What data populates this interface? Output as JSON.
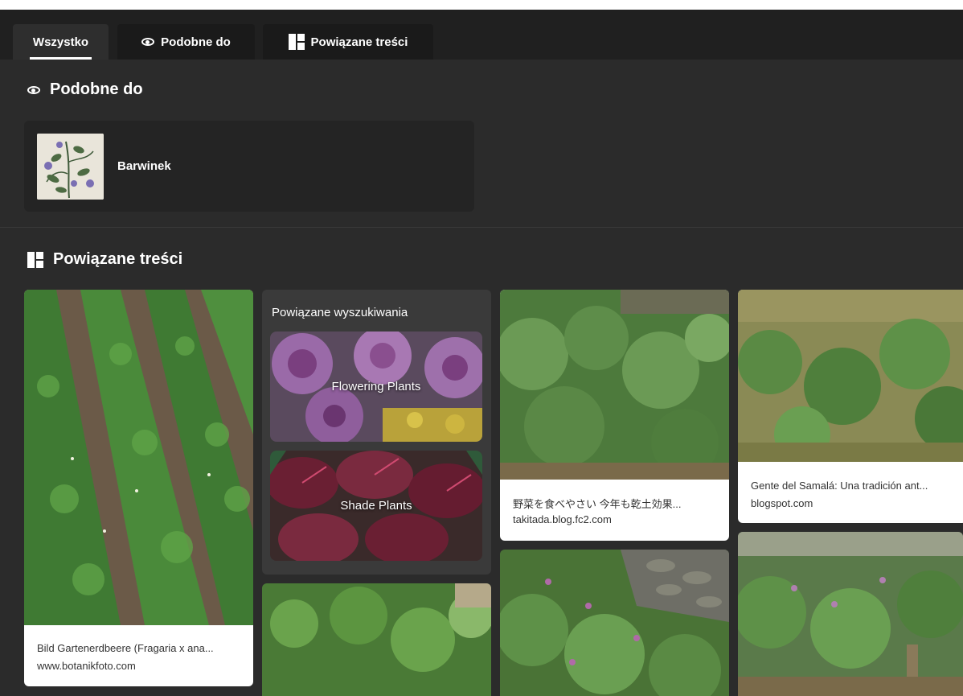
{
  "tabs": [
    {
      "label": "Wszystko",
      "active": true
    },
    {
      "label": "Podobne do",
      "icon": "eye-icon"
    },
    {
      "label": "Powiązane treści",
      "icon": "grid-icon"
    }
  ],
  "similar": {
    "title": "Podobne do",
    "item": {
      "label": "Barwinek"
    }
  },
  "related": {
    "title": "Powiązane treści",
    "searches_title": "Powiązane wyszukiwania",
    "searches": [
      {
        "label": "Flowering Plants"
      },
      {
        "label": "Shade Plants"
      }
    ],
    "cards": [
      {
        "title": "Bild Gartenerdbeere (Fragaria x ana...",
        "source": "www.botanikfoto.com"
      },
      {
        "title": "野菜を食べやさい 今年も乾土効果...",
        "source": "takitada.blog.fc2.com"
      },
      {
        "title": "Gente del Samalá: Una tradición ant...",
        "source": "blogspot.com"
      }
    ]
  },
  "colors": {
    "background": "#2b2b2b",
    "tabstrip": "#202020",
    "card": "#ffffff",
    "related_box": "#3a3a3a"
  }
}
